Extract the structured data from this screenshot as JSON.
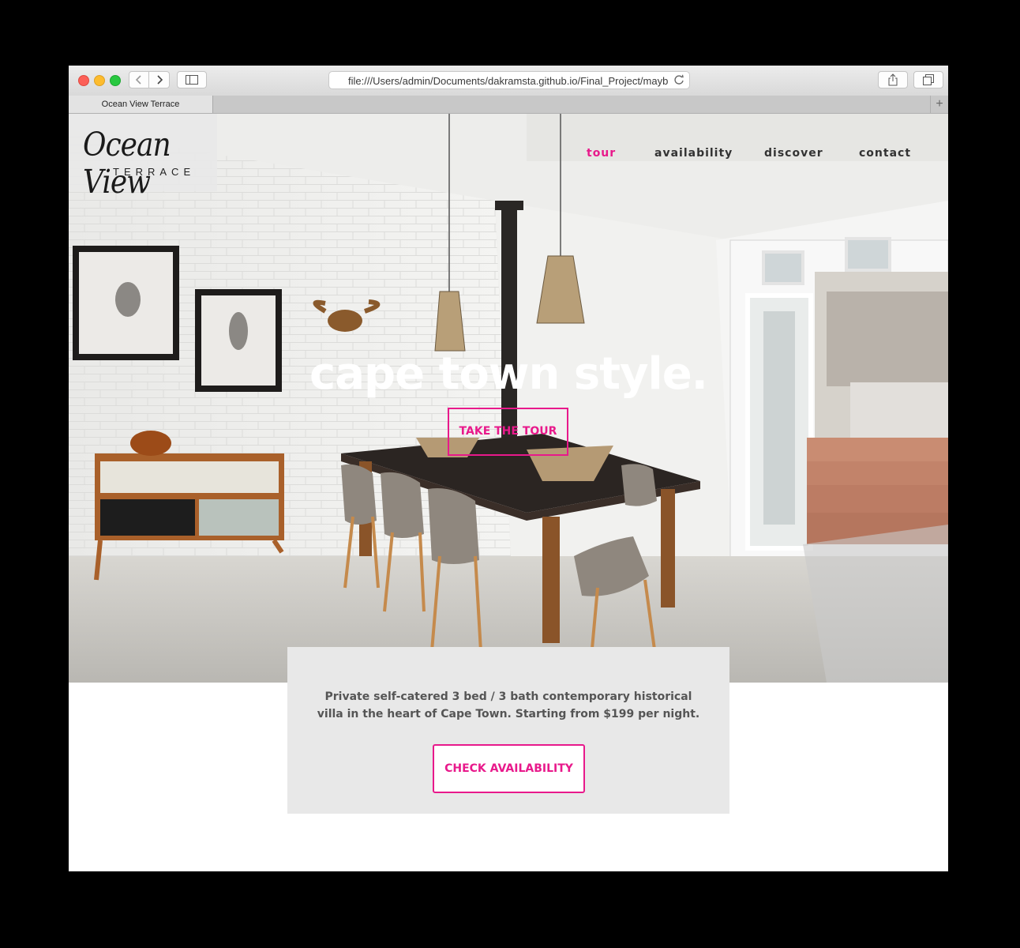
{
  "browser": {
    "url": "file:///Users/admin/Documents/dakramsta.github.io/Final_Project/mayb",
    "tab_title": "Ocean View Terrace",
    "new_tab_glyph": "+",
    "icons": [
      "back-icon",
      "forward-icon",
      "sidebar-icon",
      "reload-icon",
      "share-icon",
      "tabs-icon"
    ]
  },
  "logo": {
    "script": "Ocean View",
    "sub": "TERRACE"
  },
  "nav": {
    "items": [
      {
        "label": "tour",
        "active": true
      },
      {
        "label": "availability",
        "active": false
      },
      {
        "label": "discover",
        "active": false
      },
      {
        "label": "contact",
        "active": false
      }
    ]
  },
  "hero": {
    "headline": "cape town style.",
    "cta": "TAKE THE TOUR"
  },
  "info": {
    "text": "Private self-catered 3 bed / 3 bath contemporary historical villa in the heart of Cape Town. Starting from $199 per night.",
    "cta": "CHECK AVAILABILITY"
  },
  "colors": {
    "accent": "#e8198b",
    "nav_text": "#333333",
    "info_bg": "#e8e8e8"
  }
}
